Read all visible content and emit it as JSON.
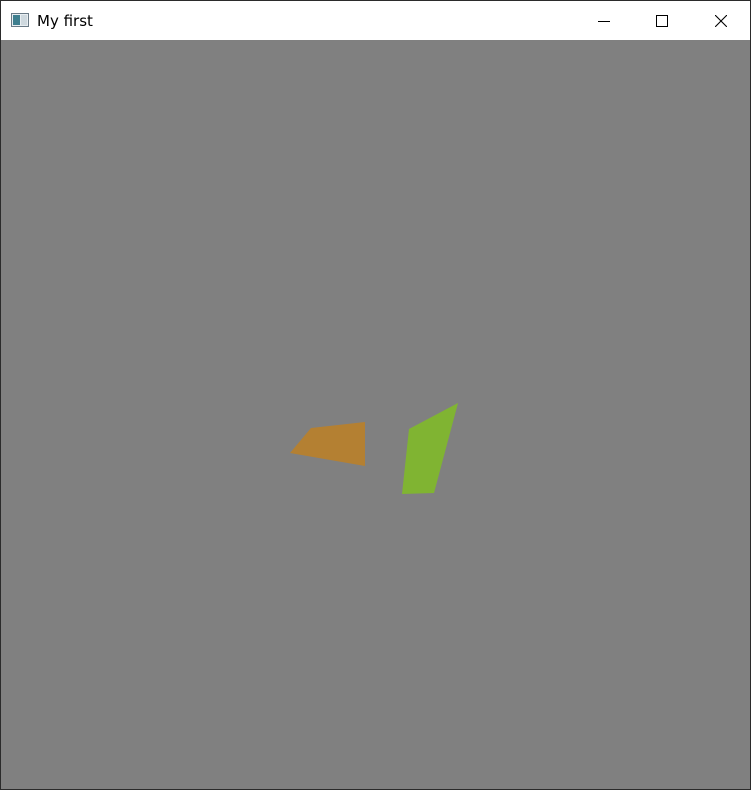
{
  "window": {
    "title": "My first",
    "icon": "app-window-icon",
    "controls": [
      "minimize-icon",
      "maximize-icon",
      "close-icon"
    ]
  },
  "viewport": {
    "background_color": "#808080",
    "shapes": [
      {
        "name": "orange-quad",
        "color": "#b48032"
      },
      {
        "name": "green-quad",
        "color": "#80b432"
      }
    ]
  }
}
